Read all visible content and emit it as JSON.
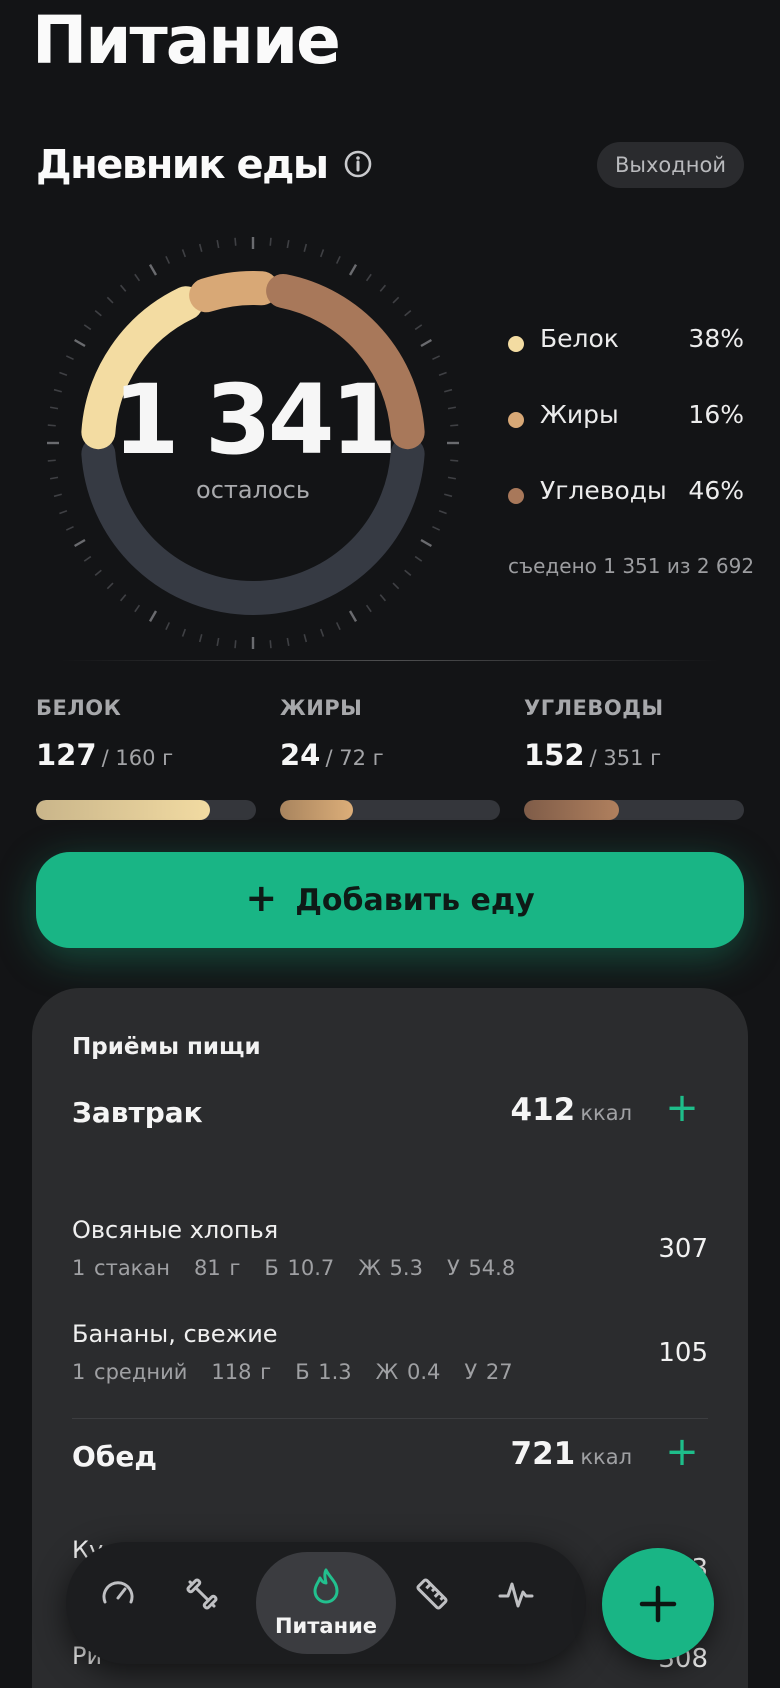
{
  "page": {
    "title": "Питание"
  },
  "diary": {
    "title": "Дневник еды",
    "day_badge": "Выходной",
    "remaining": "1 341",
    "remaining_caption": "осталось",
    "eaten_summary": "съедено 1 351 из 2 692",
    "legend": [
      {
        "label": "Белок",
        "percent": "38%",
        "color": "#f3dca2"
      },
      {
        "label": "Жиры",
        "percent": "16%",
        "color": "#d8a876"
      },
      {
        "label": "Углеводы",
        "percent": "46%",
        "color": "#a8785a"
      }
    ],
    "ring": {
      "protein_share": 0.38,
      "fat_share": 0.16,
      "carbs_share": 0.46,
      "consumed_fraction": 0.5
    }
  },
  "macros": [
    {
      "name": "БЕЛОК",
      "current": "127",
      "target": "/ 160 г",
      "progress": 0.79
    },
    {
      "name": "ЖИРЫ",
      "current": "24",
      "target": "/ 72 г",
      "progress": 0.33
    },
    {
      "name": "УГЛЕВОДЫ",
      "current": "152",
      "target": "/ 351 г",
      "progress": 0.43
    }
  ],
  "add_food": {
    "plus": "+",
    "label": "Добавить еду"
  },
  "meals": {
    "title": "Приёмы пищи",
    "kcal_unit": "ккал",
    "add_symbol": "+",
    "list": [
      {
        "name": "Завтрак",
        "kcal": "412",
        "items": [
          {
            "name": "Овсяные хлопья",
            "portion": "1 стакан",
            "weight": "81 г",
            "protein": "Б 10.7",
            "fat": "Ж 5.3",
            "carbs": "У 54.8",
            "kcal": "307"
          },
          {
            "name": "Бананы, свежие",
            "portion": "1 средний",
            "weight": "118 г",
            "protein": "Б 1.3",
            "fat": "Ж 0.4",
            "carbs": "У 27",
            "kcal": "105"
          }
        ]
      },
      {
        "name": "Обед",
        "kcal": "721",
        "items": [
          {
            "name": "Ку",
            "kcal": "3"
          },
          {
            "name": "Ри",
            "kcal": "308"
          }
        ]
      }
    ]
  },
  "tab_bar": {
    "tabs": [
      {
        "icon": "gauge-icon"
      },
      {
        "icon": "dumbbell-icon"
      },
      {
        "icon": "flame-icon",
        "label": "Питание",
        "active": true
      },
      {
        "icon": "ruler-icon"
      },
      {
        "icon": "pulse-icon"
      }
    ],
    "fab_icon": "plus-icon"
  },
  "colors": {
    "accent": "#19b585",
    "protein": "#f3dca2",
    "fat": "#d8a876",
    "carbs": "#a8785a",
    "ring_track": "#363a43"
  }
}
